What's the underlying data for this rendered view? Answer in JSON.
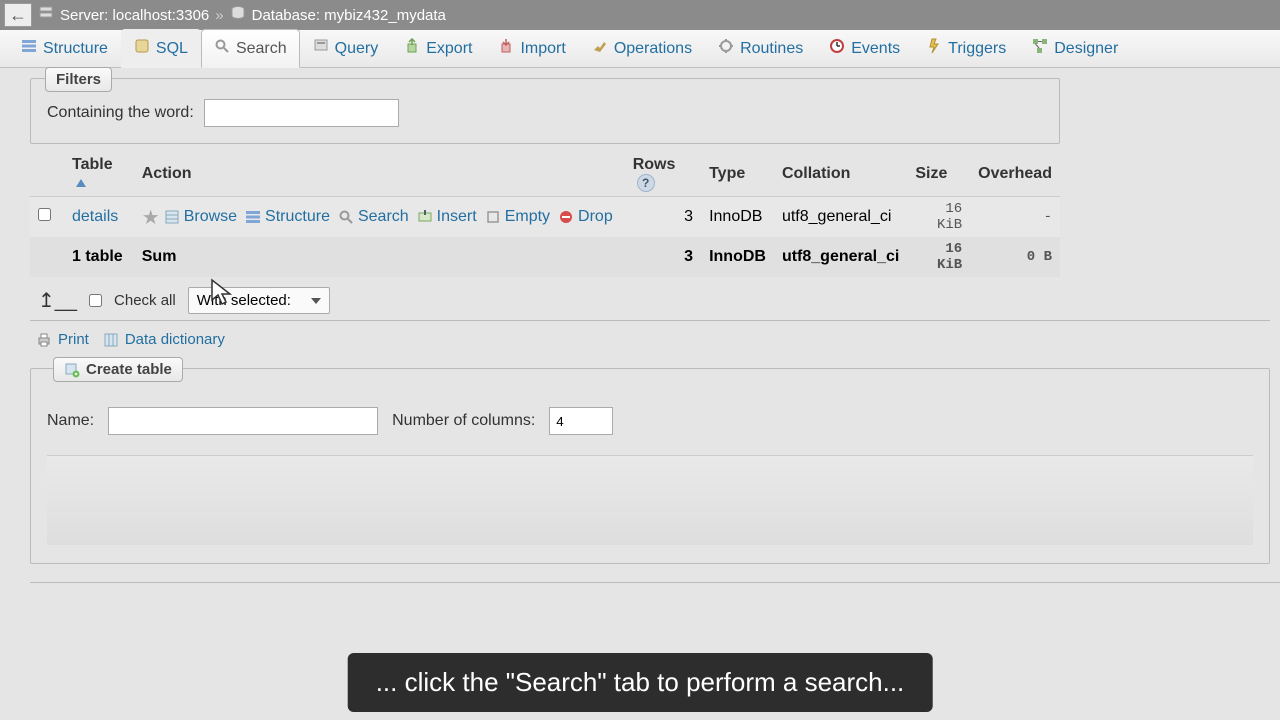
{
  "breadcrumb": {
    "server_label": "Server: localhost:3306",
    "database_label": "Database: mybiz432_mydata"
  },
  "tabs": {
    "structure": "Structure",
    "sql": "SQL",
    "search": "Search",
    "query": "Query",
    "export": "Export",
    "import": "Import",
    "operations": "Operations",
    "routines": "Routines",
    "events": "Events",
    "triggers": "Triggers",
    "designer": "Designer"
  },
  "filters": {
    "legend": "Filters",
    "containing_label": "Containing the word:",
    "containing_value": ""
  },
  "table": {
    "headers": {
      "table": "Table",
      "action": "Action",
      "rows": "Rows",
      "type": "Type",
      "collation": "Collation",
      "size": "Size",
      "overhead": "Overhead"
    },
    "rows": [
      {
        "name": "details",
        "actions": {
          "browse": "Browse",
          "structure": "Structure",
          "search": "Search",
          "insert": "Insert",
          "empty": "Empty",
          "drop": "Drop"
        },
        "rows_count": "3",
        "type": "InnoDB",
        "collation": "utf8_general_ci",
        "size": "16 KiB",
        "overhead": "-"
      }
    ],
    "summary": {
      "count_label": "1 table",
      "sum_label": "Sum",
      "rows_count": "3",
      "type": "InnoDB",
      "collation": "utf8_general_ci",
      "size": "16 KiB",
      "overhead": "0 B"
    }
  },
  "bulk": {
    "check_all": "Check all",
    "with_selected": "With selected:"
  },
  "utils": {
    "print": "Print",
    "data_dictionary": "Data dictionary"
  },
  "create_table": {
    "legend": "Create table",
    "name_label": "Name:",
    "name_value": "",
    "cols_label": "Number of columns:",
    "cols_value": "4"
  },
  "caption": "... click the \"Search\" tab to perform a search..."
}
